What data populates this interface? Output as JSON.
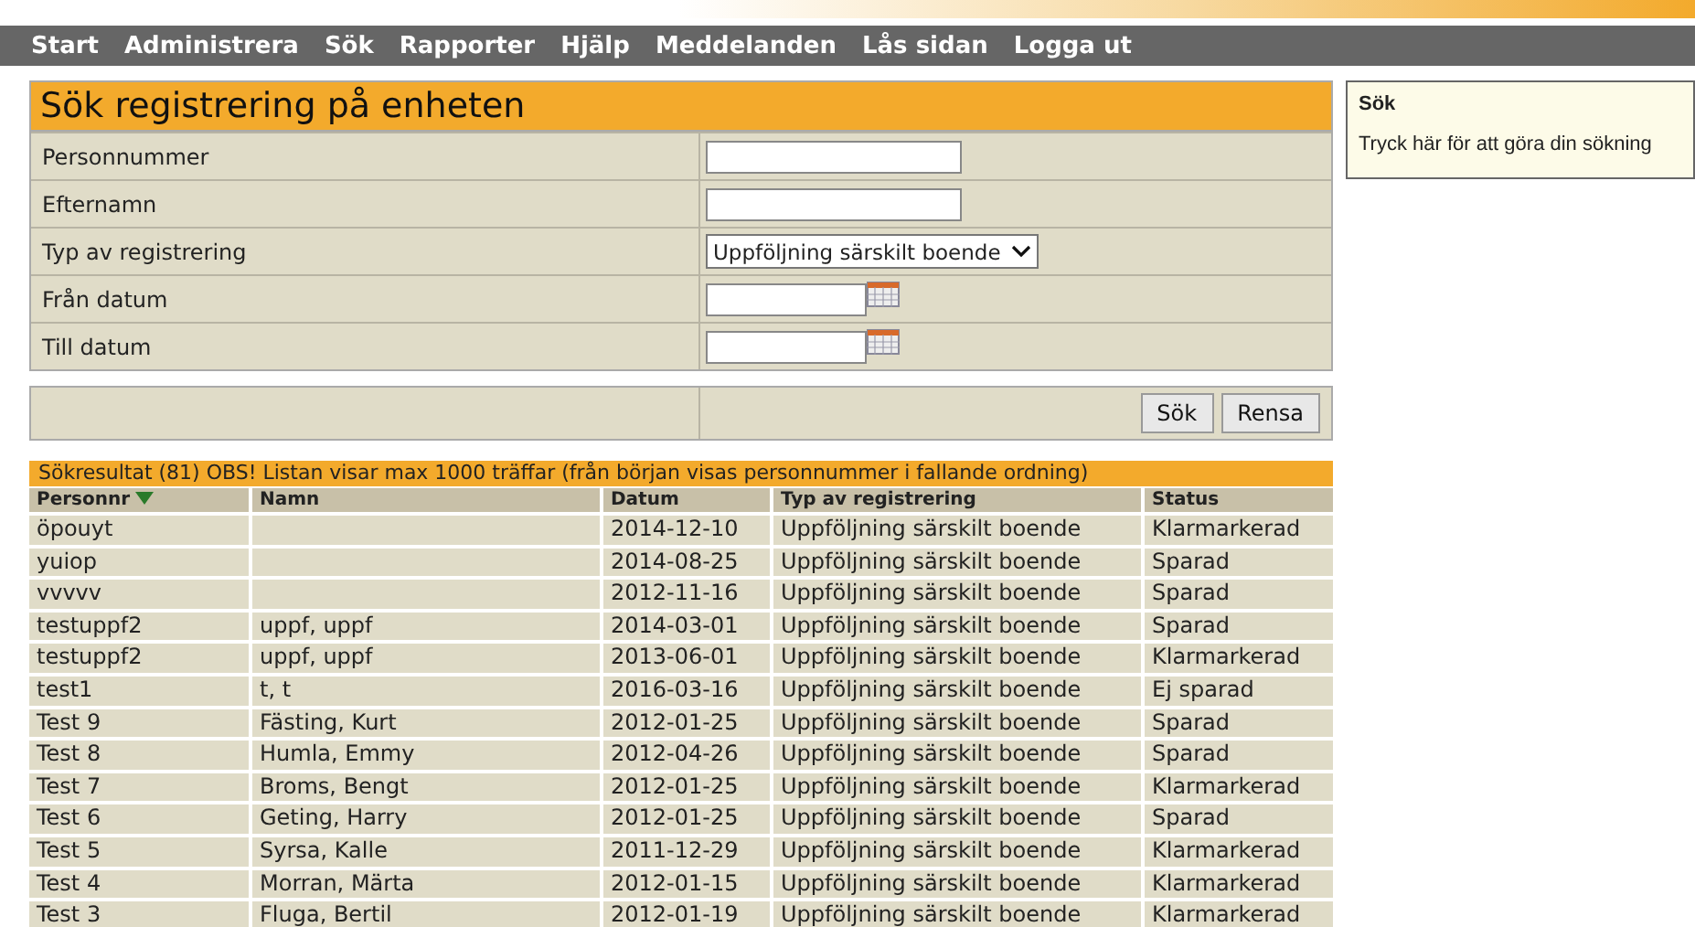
{
  "nav": [
    {
      "label": "Start"
    },
    {
      "label": "Administrera"
    },
    {
      "label": "Sök"
    },
    {
      "label": "Rapporter"
    },
    {
      "label": "Hjälp"
    },
    {
      "label": "Meddelanden"
    },
    {
      "label": "Lås sidan"
    },
    {
      "label": "Logga ut"
    }
  ],
  "search_form": {
    "title": "Sök registrering på enheten",
    "fields": [
      {
        "label": "Personnummer",
        "kind": "text"
      },
      {
        "label": "Efternamn",
        "kind": "text"
      },
      {
        "label": "Typ av registrering",
        "kind": "select",
        "value": "Uppföljning särskilt boende"
      },
      {
        "label": "Från datum",
        "kind": "date"
      },
      {
        "label": "Till datum",
        "kind": "date"
      }
    ],
    "buttons": [
      "Sök",
      "Rensa"
    ]
  },
  "help_box": {
    "title": "Sök",
    "text": "Tryck här för att göra din sökning"
  },
  "results": {
    "summary": "Sökresultat (81) OBS! Listan visar max 1000 träffar (från början visas personnummer i fallande ordning)",
    "columns": [
      {
        "label": "Personnr",
        "sorted": true
      },
      {
        "label": "Namn",
        "sorted": false
      },
      {
        "label": "Datum",
        "sorted": false
      },
      {
        "label": "Typ av registrering",
        "sorted": false
      },
      {
        "label": "Status",
        "sorted": false
      }
    ],
    "rows": [
      [
        "öpouyt",
        "",
        "2014-12-10",
        "Uppföljning särskilt boende",
        "Klarmarkerad"
      ],
      [
        "yuiop",
        "",
        "2014-08-25",
        "Uppföljning särskilt boende",
        "Sparad"
      ],
      [
        "vvvvv",
        "",
        "2012-11-16",
        "Uppföljning särskilt boende",
        "Sparad"
      ],
      [
        "testuppf2",
        "uppf, uppf",
        "2014-03-01",
        "Uppföljning särskilt boende",
        "Sparad"
      ],
      [
        "testuppf2",
        "uppf, uppf",
        "2013-06-01",
        "Uppföljning särskilt boende",
        "Klarmarkerad"
      ],
      [
        "test1",
        "t, t",
        "2016-03-16",
        "Uppföljning särskilt boende",
        "Ej sparad"
      ],
      [
        "Test 9",
        "Fästing, Kurt",
        "2012-01-25",
        "Uppföljning särskilt boende",
        "Sparad"
      ],
      [
        "Test 8",
        "Humla, Emmy",
        "2012-04-26",
        "Uppföljning särskilt boende",
        "Sparad"
      ],
      [
        "Test 7",
        "Broms, Bengt",
        "2012-01-25",
        "Uppföljning särskilt boende",
        "Klarmarkerad"
      ],
      [
        "Test 6",
        "Geting, Harry",
        "2012-01-25",
        "Uppföljning särskilt boende",
        "Sparad"
      ],
      [
        "Test 5",
        "Syrsa, Kalle",
        "2011-12-29",
        "Uppföljning särskilt boende",
        "Klarmarkerad"
      ],
      [
        "Test 4",
        "Morran, Märta",
        "2012-01-15",
        "Uppföljning särskilt boende",
        "Klarmarkerad"
      ],
      [
        "Test 3",
        "Fluga, Bertil",
        "2012-01-19",
        "Uppföljning särskilt boende",
        "Klarmarkerad"
      ]
    ]
  }
}
